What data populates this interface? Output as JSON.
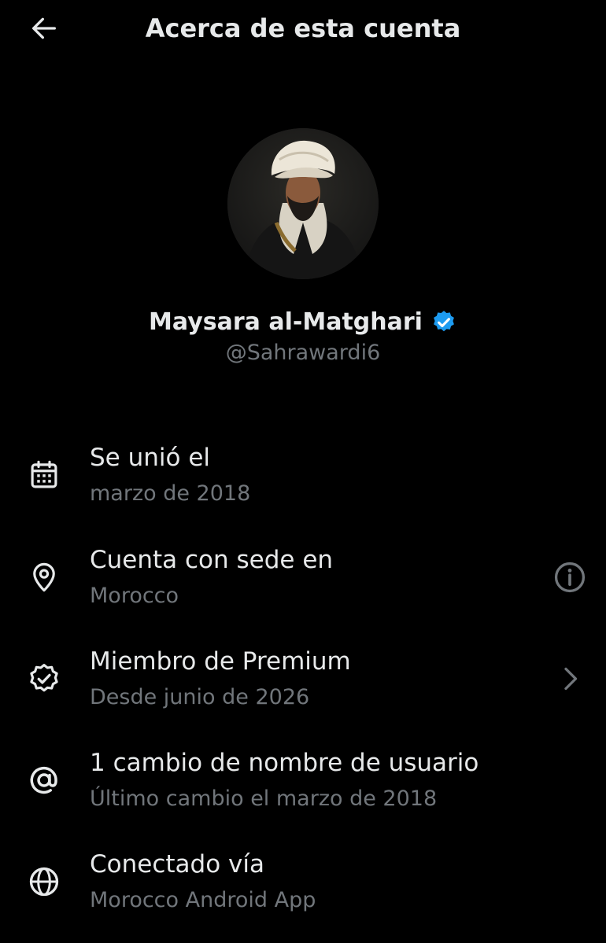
{
  "header": {
    "title": "Acerca de esta cuenta",
    "back_icon": "arrow-left-icon"
  },
  "profile": {
    "name": "Maysara al-Matghari",
    "handle": "@Sahrawardi6",
    "verified_icon": "verified-badge-icon",
    "verified_color": "#1d9bf0"
  },
  "details": [
    {
      "icon": "calendar-icon",
      "primary": "Se unió el",
      "secondary": "marzo de 2018"
    },
    {
      "icon": "location-pin-icon",
      "primary": "Cuenta con sede en",
      "secondary": "Morocco",
      "action_icon": "info-icon"
    },
    {
      "icon": "premium-badge-icon",
      "primary": "Miembro de Premium",
      "secondary": "Desde junio de 2026",
      "action_icon": "chevron-right-icon"
    },
    {
      "icon": "at-sign-icon",
      "primary": "1 cambio de nombre de usuario",
      "secondary": "Último cambio el marzo de 2018"
    },
    {
      "icon": "globe-icon",
      "primary": "Conectado vía",
      "secondary": "Morocco Android App"
    }
  ],
  "colors": {
    "background": "#000000",
    "primary_text": "#e7e9ea",
    "secondary_text": "#71767b",
    "accent": "#1d9bf0"
  }
}
